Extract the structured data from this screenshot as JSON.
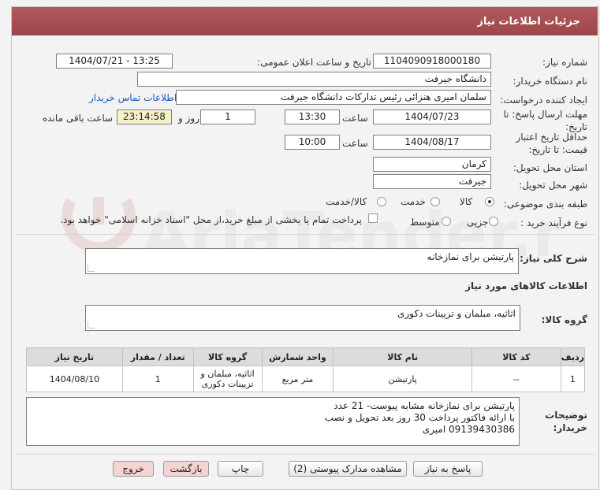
{
  "header": {
    "title": "جزئیات اطلاعات نیاز"
  },
  "form": {
    "need_number_label": "شماره نیاز:",
    "need_number": "1104090918000180",
    "announce_label": "تاریخ و ساعت اعلان عمومی:",
    "announce_value": "1404/07/21 - 13:25",
    "buyer_org_label": "نام دستگاه خریدار:",
    "buyer_org": "دانشگاه جیرفت",
    "creator_label": "ایجاد کننده درخواست:",
    "creator": "سلمان امیری هنزائی رئیس تدارکات دانشگاه جیرفت",
    "contact_link": "اطلاعات تماس خریدار",
    "deadline_label": "مهلت ارسال پاسخ: تا تاریخ:",
    "deadline_date": "1404/07/23",
    "time_label": "ساعت",
    "deadline_time": "13:30",
    "days_value": "1",
    "days_label": "روز و",
    "remaining_time": "23:14:58",
    "remaining_label": "ساعت باقی مانده",
    "validity_label": "حداقل تاریخ اعتبار قیمت: تا تاریخ:",
    "validity_date": "1404/08/17",
    "validity_time": "10:00",
    "province_label": "استان محل تحویل:",
    "province": "کرمان",
    "city_label": "شهر محل تحویل:",
    "city": "جیرفت",
    "category_label": "طبقه بندی موضوعی:",
    "category_options": [
      "کالا",
      "خدمت",
      "کالا/خدمت"
    ],
    "category_selected": "کالا",
    "process_label": "نوع فرآیند خرید :",
    "process_options": [
      "جزیی",
      "متوسط"
    ],
    "payment_note": "پرداخت تمام یا بخشی از مبلغ خرید،از محل \"اسناد خزانه اسلامی\" خواهد بود."
  },
  "summary": {
    "label": "شرح کلی نیاز:",
    "value": "پارتیشن برای نمازخانه"
  },
  "goods": {
    "section_title": "اطلاعات کالاهای مورد نیاز",
    "group_label": "گروه کالا:",
    "group_value": "اثاثیه، مبلمان و تزیینات دکوری",
    "columns": [
      "ردیف",
      "کد کالا",
      "نام کالا",
      "واحد شمارش",
      "گروه کالا",
      "تعداد / مقدار",
      "تاریخ نیاز"
    ],
    "rows": [
      {
        "row": "1",
        "code": "--",
        "name": "پارتیشن",
        "unit": "متر مربع",
        "group": "اثاثیه، مبلمان و تزیینات دکوری",
        "qty": "1",
        "date": "1404/08/10"
      }
    ]
  },
  "buyer_notes": {
    "label": "توضیحات خریدار:",
    "lines": [
      "پارتیشن برای نمازخانه مشابه پیوست- 21 عدد",
      "با ارائه فاکتور پرداخت 30 روز بعد تحویل و نصب",
      "09139430386 امیری"
    ]
  },
  "buttons": {
    "reply": "پاسخ به نیاز",
    "attachments": "مشاهده مدارک پیوستی (2)",
    "print": "چاپ",
    "back": "بازگشت",
    "exit": "خروج"
  },
  "watermark": {
    "text": "AriaTender.neT"
  },
  "colors": {
    "title_bg": "#a44d51",
    "link": "#1a56c7",
    "time_bg": "#f7f1c5"
  }
}
